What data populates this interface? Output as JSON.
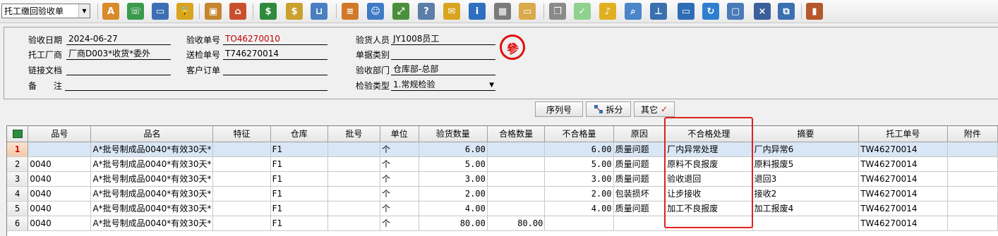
{
  "toolbar": {
    "doc_type_value": "托工缴回验收单",
    "icons": [
      {
        "name": "spellcheck-icon",
        "color": "#d98a2b",
        "glyph": "A"
      },
      {
        "name": "phone-icon",
        "color": "#3a9a4c",
        "glyph": "☏"
      },
      {
        "name": "computer-icon",
        "color": "#3d6fb5",
        "glyph": "▭"
      },
      {
        "name": "lock-icon",
        "color": "#d9a520",
        "glyph": "🔒"
      },
      {
        "name": "briefcase-icon",
        "color": "#c5862f",
        "glyph": "▣"
      },
      {
        "name": "home-icon",
        "color": "#c8502e",
        "glyph": "⌂"
      },
      {
        "name": "dollar-icon",
        "color": "#2f8a3d",
        "glyph": "$"
      },
      {
        "name": "money-bag-icon",
        "color": "#c9a12c",
        "glyph": "$"
      },
      {
        "name": "shopping-cart-icon",
        "color": "#4a7fc0",
        "glyph": "⊔"
      },
      {
        "name": "clipboard-icon",
        "color": "#d2782a",
        "glyph": "≡"
      },
      {
        "name": "users-icon",
        "color": "#3f7bc4",
        "glyph": "☺"
      },
      {
        "name": "expand-arrows-icon",
        "color": "#4a8f3b",
        "glyph": "⤢"
      },
      {
        "name": "help-document-icon",
        "color": "#5a7ea8",
        "glyph": "?"
      },
      {
        "name": "mail-icon",
        "color": "#d9a520",
        "glyph": "✉"
      },
      {
        "name": "info-icon",
        "color": "#2f6fc0",
        "glyph": "i"
      },
      {
        "name": "calculator-icon",
        "color": "#7a7a7a",
        "glyph": "▦"
      },
      {
        "name": "folder-icon",
        "color": "#d9a94a",
        "glyph": "▭"
      },
      {
        "name": "copy-document-icon",
        "color": "#8a8a8a",
        "glyph": "❐"
      },
      {
        "name": "check-circle-icon",
        "color": "#8fd18f",
        "glyph": "✓"
      },
      {
        "name": "bell-icon",
        "color": "#e0b020",
        "glyph": "♪"
      },
      {
        "name": "search-icon",
        "color": "#4a86c8",
        "glyph": "⌕"
      },
      {
        "name": "org-chart-icon",
        "color": "#3a6fb0",
        "glyph": "⊥"
      },
      {
        "name": "monitor-icon",
        "color": "#2e6db5",
        "glyph": "▭"
      },
      {
        "name": "refresh-icon",
        "color": "#2f7fd0",
        "glyph": "↻"
      },
      {
        "name": "window-icon",
        "color": "#4a7ab8",
        "glyph": "▢"
      },
      {
        "name": "close-window-icon",
        "color": "#3a5f9a",
        "glyph": "×"
      },
      {
        "name": "restore-window-icon",
        "color": "#3a6fb0",
        "glyph": "⧉"
      },
      {
        "name": "exit-door-icon",
        "color": "#b5582c",
        "glyph": "▮"
      }
    ]
  },
  "form": {
    "inspect_date_label": "验收日期",
    "inspect_date_value": "2024-06-27",
    "inspect_no_label": "验收单号",
    "inspect_no_value": "TO46270010",
    "inspector_label": "验货人员",
    "inspector_value": "JY1008员工",
    "vendor_label": "托工厂商",
    "vendor_value": "厂商D003*收货*委外",
    "delivery_no_label": "送检单号",
    "delivery_no_value": "T746270014",
    "doc_category_label": "单据类别",
    "doc_category_value": "",
    "link_doc_label": "链接文档",
    "link_doc_value": "",
    "customer_order_label": "客户订单",
    "customer_order_value": "",
    "dept_label": "验收部门",
    "dept_value": "仓库部-总部",
    "remark_label": "备　　注",
    "remark_value": "",
    "inspect_type_label": "检验类型",
    "inspect_type_value": "1.常规检验",
    "stamp_text": "參"
  },
  "buttons": {
    "serial_label": "序列号",
    "split_label": "拆分",
    "other_label": "其它",
    "other_check": "✓"
  },
  "grid": {
    "columns": [
      "品号",
      "品名",
      "特征",
      "仓库",
      "批号",
      "单位",
      "验货数量",
      "合格数量",
      "不合格量",
      "原因",
      "不合格处理",
      "摘要",
      "托工单号",
      "附件"
    ],
    "rows": [
      {
        "no": "1",
        "item": "",
        "name": "A*批号制成品0040*有效30天*",
        "feature": "",
        "warehouse": "F1",
        "batch": "",
        "unit": "个",
        "qty": "6.00",
        "pass": "",
        "fail": "6.00",
        "reason": "质量问题",
        "handling": "厂内异常处理",
        "summary": "厂内异常6",
        "order": "TW46270014",
        "attach": ""
      },
      {
        "no": "2",
        "item": "0040",
        "name": "A*批号制成品0040*有效30天*",
        "feature": "",
        "warehouse": "F1",
        "batch": "",
        "unit": "个",
        "qty": "5.00",
        "pass": "",
        "fail": "5.00",
        "reason": "质量问题",
        "handling": "原料不良报废",
        "summary": "原料报废5",
        "order": "TW46270014",
        "attach": ""
      },
      {
        "no": "3",
        "item": "0040",
        "name": "A*批号制成品0040*有效30天*",
        "feature": "",
        "warehouse": "F1",
        "batch": "",
        "unit": "个",
        "qty": "3.00",
        "pass": "",
        "fail": "3.00",
        "reason": "质量问题",
        "handling": "验收退回",
        "summary": "退回3",
        "order": "TW46270014",
        "attach": ""
      },
      {
        "no": "4",
        "item": "0040",
        "name": "A*批号制成品0040*有效30天*",
        "feature": "",
        "warehouse": "F1",
        "batch": "",
        "unit": "个",
        "qty": "2.00",
        "pass": "",
        "fail": "2.00",
        "reason": "包装损坏",
        "handling": "让步接收",
        "summary": "接收2",
        "order": "TW46270014",
        "attach": ""
      },
      {
        "no": "5",
        "item": "0040",
        "name": "A*批号制成品0040*有效30天*",
        "feature": "",
        "warehouse": "F1",
        "batch": "",
        "unit": "个",
        "qty": "4.00",
        "pass": "",
        "fail": "4.00",
        "reason": "质量问题",
        "handling": "加工不良报废",
        "summary": "加工报废4",
        "order": "TW46270014",
        "attach": ""
      },
      {
        "no": "6",
        "item": "0040",
        "name": "A*批号制成品0040*有效30天*",
        "feature": "",
        "warehouse": "F1",
        "batch": "",
        "unit": "个",
        "qty": "80.00",
        "pass": "80.00",
        "fail": "",
        "reason": "",
        "handling": "",
        "summary": "",
        "order": "TW46270014",
        "attach": ""
      }
    ]
  }
}
